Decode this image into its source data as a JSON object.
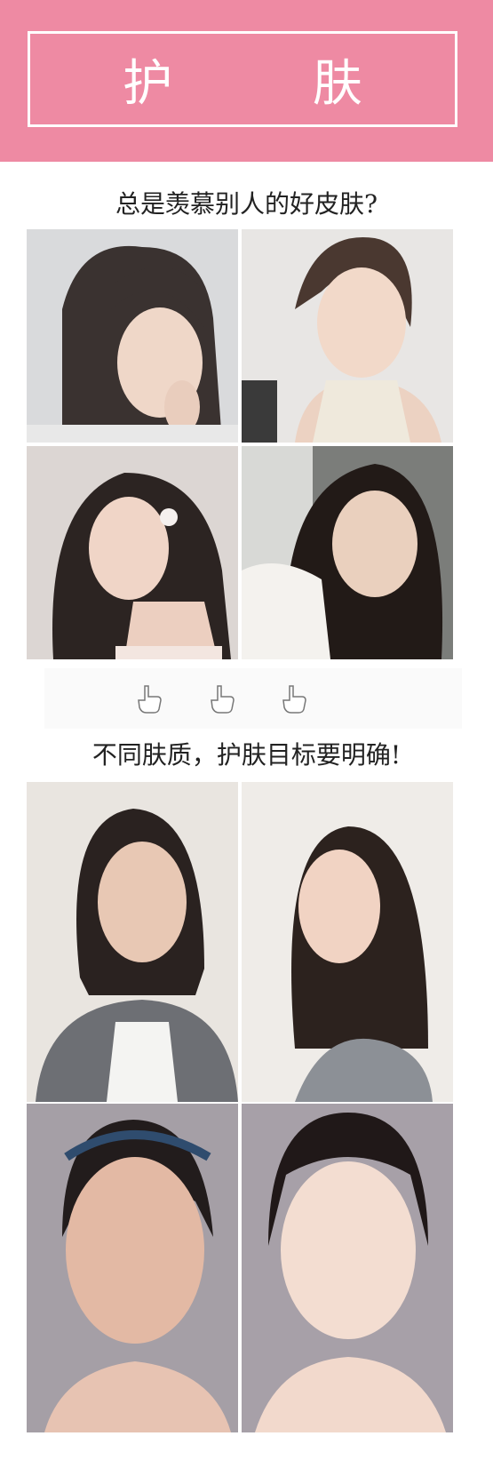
{
  "header": {
    "title": "护 肤"
  },
  "captions": {
    "envy": "总是羡慕别人的好皮肤?",
    "goal": "不同肤质，护肤目标要明确!"
  },
  "icons": [
    "pointing-hand-icon",
    "pointing-hand-icon",
    "pointing-hand-icon"
  ],
  "colors": {
    "header_bg": "#ee8aa3",
    "frame": "#ffffff",
    "text": "#222222"
  }
}
